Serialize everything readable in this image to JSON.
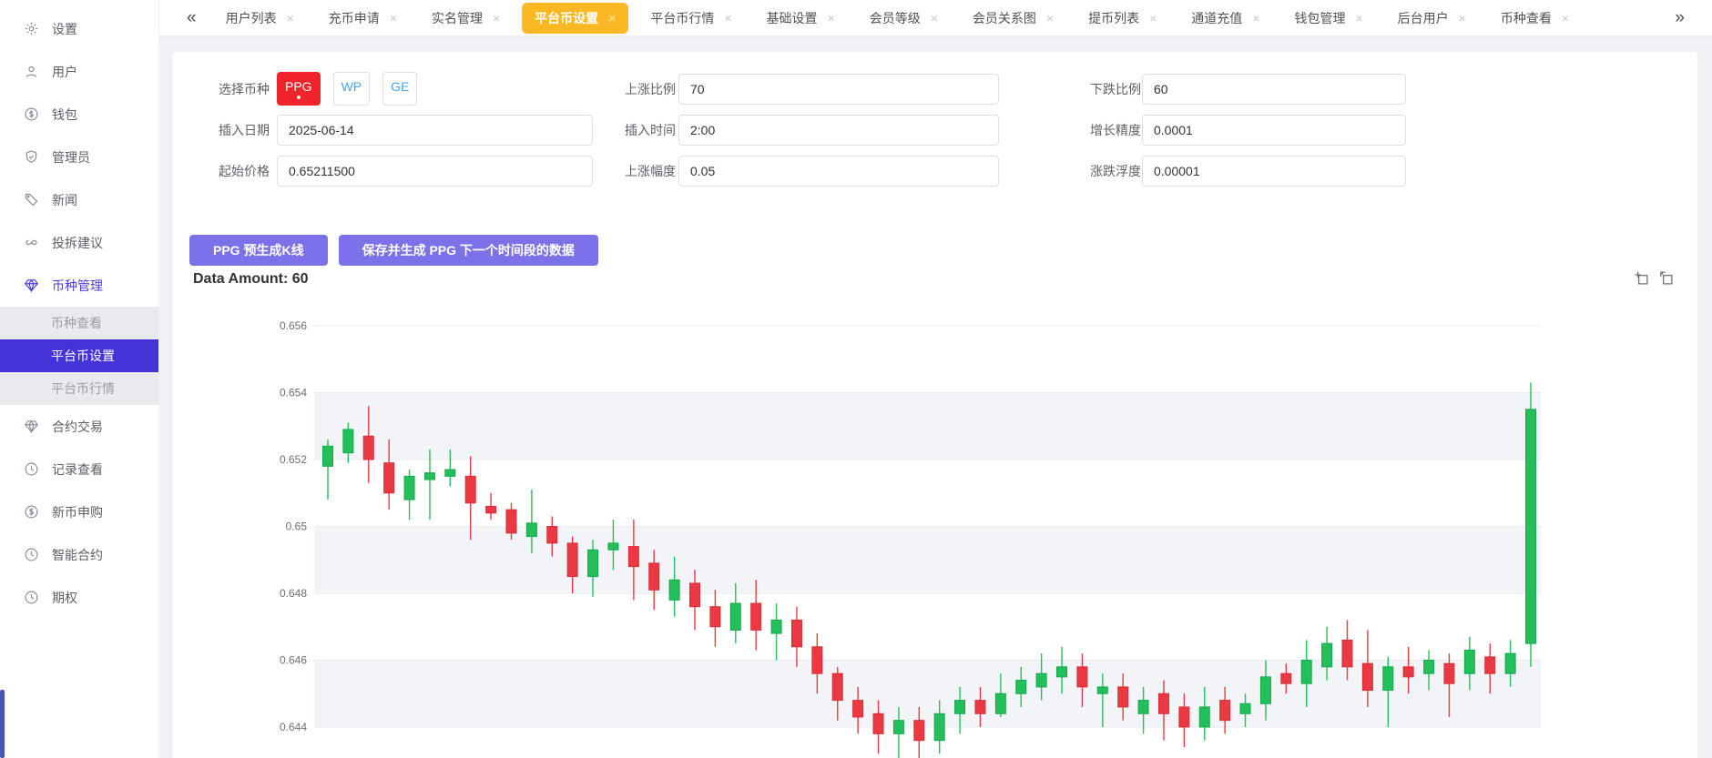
{
  "sidebar": {
    "items": [
      {
        "label": "设置",
        "icon": "gear"
      },
      {
        "label": "用户",
        "icon": "user"
      },
      {
        "label": "钱包",
        "icon": "wallet"
      },
      {
        "label": "管理员",
        "icon": "shield"
      },
      {
        "label": "新闻",
        "icon": "tag"
      },
      {
        "label": "投拆建议",
        "icon": "link"
      },
      {
        "label": "币种管理",
        "icon": "diamond",
        "active": true,
        "children": [
          {
            "label": "币种查看",
            "active": false
          },
          {
            "label": "平台币设置",
            "active": true
          },
          {
            "label": "平台币行情",
            "active": false
          }
        ]
      },
      {
        "label": "合约交易",
        "icon": "diamond"
      },
      {
        "label": "记录查看",
        "icon": "clock"
      },
      {
        "label": "新币申购",
        "icon": "wallet"
      },
      {
        "label": "智能合约",
        "icon": "clock"
      },
      {
        "label": "期权",
        "icon": "clock"
      }
    ]
  },
  "tabbar": {
    "left_chevron": "«",
    "right_chevron": "»",
    "close_glyph": "×",
    "tabs": [
      {
        "label": "用户列表",
        "active": false
      },
      {
        "label": "充币申请",
        "active": false
      },
      {
        "label": "实名管理",
        "active": false
      },
      {
        "label": "平台币设置",
        "active": true
      },
      {
        "label": "平台币行情",
        "active": false
      },
      {
        "label": "基础设置",
        "active": false
      },
      {
        "label": "会员等级",
        "active": false
      },
      {
        "label": "会员关系图",
        "active": false
      },
      {
        "label": "提币列表",
        "active": false
      },
      {
        "label": "通道充值",
        "active": false
      },
      {
        "label": "钱包管理",
        "active": false
      },
      {
        "label": "后台用户",
        "active": false
      },
      {
        "label": "币种查看",
        "active": false
      }
    ]
  },
  "form": {
    "coin_label": "选择币种",
    "coins": [
      {
        "label": "PPG",
        "active": true
      },
      {
        "label": "WP",
        "active": false
      },
      {
        "label": "GE",
        "active": false
      }
    ],
    "fields": [
      {
        "label": "上涨比例",
        "value": "70"
      },
      {
        "label": "下跌比例",
        "value": "60"
      },
      {
        "label": "插入日期",
        "value": "2025-06-14"
      },
      {
        "label": "插入时间",
        "value": "2:00"
      },
      {
        "label": "增长精度",
        "value": "0.0001"
      },
      {
        "label": "起始价格",
        "value": "0.65211500"
      },
      {
        "label": "上涨幅度",
        "value": "0.05"
      },
      {
        "label": "涨跌浮度",
        "value": "0.00001"
      }
    ],
    "buttons": [
      {
        "label": "PPG 预生成K线"
      },
      {
        "label": "保存并生成 PPG 下一个时间段的数据"
      }
    ]
  },
  "chart": {
    "data_amount_label": "Data Amount: 60"
  },
  "colors": {
    "active_tab": "#fcb822",
    "active_menu": "#4434d8",
    "primary_button": "#7b71e8",
    "coin_active": "#f1232b",
    "coin_link": "#3da8f5",
    "candle_up": "#22bf5b",
    "candle_down": "#ea3943"
  },
  "chart_data": {
    "type": "candlestick",
    "title": "",
    "xlabel": "",
    "ylabel": "",
    "y_ticks": [
      0.656,
      0.654,
      0.652,
      0.65,
      0.648,
      0.646,
      0.644
    ],
    "ylim": [
      0.643,
      0.6565
    ],
    "grid": true,
    "split_area": true,
    "up_color": "#22bf5b",
    "up_border": "#17a84b",
    "down_color": "#ea3943",
    "down_border": "#d43038",
    "candles_format": "[open, close, low, high]",
    "candles": [
      [
        0.6518,
        0.6524,
        0.6508,
        0.6526
      ],
      [
        0.6522,
        0.6529,
        0.6519,
        0.6531
      ],
      [
        0.6527,
        0.652,
        0.6513,
        0.6536
      ],
      [
        0.6519,
        0.651,
        0.6505,
        0.6526
      ],
      [
        0.6508,
        0.6515,
        0.6502,
        0.6517
      ],
      [
        0.6514,
        0.6516,
        0.6502,
        0.6523
      ],
      [
        0.6515,
        0.6517,
        0.6512,
        0.6523
      ],
      [
        0.6515,
        0.6507,
        0.6496,
        0.6521
      ],
      [
        0.6506,
        0.6504,
        0.6502,
        0.651
      ],
      [
        0.6505,
        0.6498,
        0.6496,
        0.6507
      ],
      [
        0.6497,
        0.6501,
        0.6492,
        0.6511
      ],
      [
        0.65,
        0.6495,
        0.6491,
        0.6503
      ],
      [
        0.6495,
        0.6485,
        0.648,
        0.6497
      ],
      [
        0.6485,
        0.6493,
        0.6479,
        0.6496
      ],
      [
        0.6493,
        0.6495,
        0.6487,
        0.6502
      ],
      [
        0.6494,
        0.6488,
        0.6478,
        0.6502
      ],
      [
        0.6489,
        0.6481,
        0.6475,
        0.6493
      ],
      [
        0.6478,
        0.6484,
        0.6473,
        0.6491
      ],
      [
        0.6483,
        0.6476,
        0.6469,
        0.6487
      ],
      [
        0.6476,
        0.647,
        0.6464,
        0.6481
      ],
      [
        0.6469,
        0.6477,
        0.6465,
        0.6483
      ],
      [
        0.6477,
        0.6469,
        0.6463,
        0.6484
      ],
      [
        0.6468,
        0.6472,
        0.646,
        0.6477
      ],
      [
        0.6472,
        0.6464,
        0.6458,
        0.6476
      ],
      [
        0.6464,
        0.6456,
        0.645,
        0.6468
      ],
      [
        0.6456,
        0.6448,
        0.6442,
        0.6458
      ],
      [
        0.6448,
        0.6443,
        0.6438,
        0.6452
      ],
      [
        0.6444,
        0.6438,
        0.6432,
        0.6448
      ],
      [
        0.6438,
        0.6442,
        0.6428,
        0.6446
      ],
      [
        0.6442,
        0.6436,
        0.643,
        0.6446
      ],
      [
        0.6436,
        0.6444,
        0.6432,
        0.6448
      ],
      [
        0.6444,
        0.6448,
        0.6438,
        0.6452
      ],
      [
        0.6448,
        0.6444,
        0.644,
        0.6452
      ],
      [
        0.6444,
        0.645,
        0.6443,
        0.6456
      ],
      [
        0.645,
        0.6454,
        0.6446,
        0.6458
      ],
      [
        0.6452,
        0.6456,
        0.6448,
        0.6462
      ],
      [
        0.6455,
        0.6458,
        0.645,
        0.6464
      ],
      [
        0.6458,
        0.6452,
        0.6446,
        0.6462
      ],
      [
        0.645,
        0.6452,
        0.644,
        0.6456
      ],
      [
        0.6452,
        0.6446,
        0.6442,
        0.6456
      ],
      [
        0.6444,
        0.6448,
        0.6438,
        0.6452
      ],
      [
        0.645,
        0.6444,
        0.6436,
        0.6454
      ],
      [
        0.6446,
        0.644,
        0.6434,
        0.645
      ],
      [
        0.644,
        0.6446,
        0.6436,
        0.6452
      ],
      [
        0.6448,
        0.6442,
        0.6438,
        0.6452
      ],
      [
        0.6444,
        0.6447,
        0.644,
        0.645
      ],
      [
        0.6447,
        0.6455,
        0.6442,
        0.646
      ],
      [
        0.6456,
        0.6453,
        0.645,
        0.6459
      ],
      [
        0.6453,
        0.646,
        0.6446,
        0.6466
      ],
      [
        0.6458,
        0.6465,
        0.6454,
        0.647
      ],
      [
        0.6466,
        0.6458,
        0.6454,
        0.6472
      ],
      [
        0.6459,
        0.6451,
        0.6446,
        0.6469
      ],
      [
        0.6451,
        0.6458,
        0.644,
        0.6461
      ],
      [
        0.6458,
        0.6455,
        0.645,
        0.6464
      ],
      [
        0.6456,
        0.646,
        0.6451,
        0.6463
      ],
      [
        0.6459,
        0.6453,
        0.6443,
        0.6462
      ],
      [
        0.6456,
        0.6463,
        0.6451,
        0.6467
      ],
      [
        0.6461,
        0.6456,
        0.645,
        0.6465
      ],
      [
        0.6456,
        0.6462,
        0.6452,
        0.6466
      ],
      [
        0.6465,
        0.6535,
        0.6458,
        0.6543
      ]
    ]
  }
}
